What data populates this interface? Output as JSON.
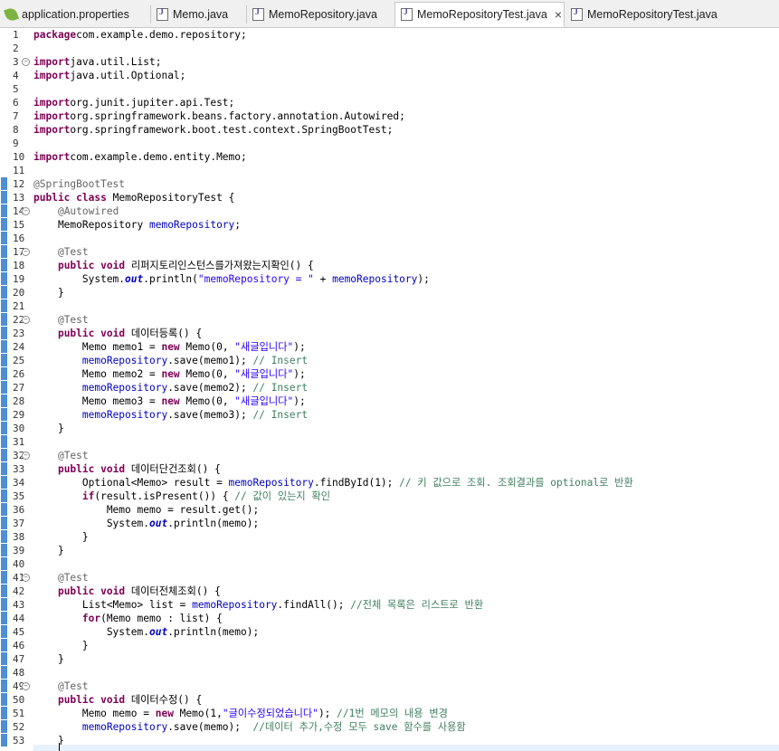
{
  "tabs": [
    {
      "label": "application.properties",
      "icon": "properties-leaf-icon"
    },
    {
      "label": "Memo.java",
      "icon": "java-file-icon"
    },
    {
      "label": "MemoRepository.java",
      "icon": "java-file-icon"
    },
    {
      "label": "MemoRepositoryTest.java",
      "icon": "java-file-icon",
      "active": true,
      "close": "×"
    },
    {
      "label": "MemoRepositoryTest.java",
      "icon": "java-file-icon"
    }
  ],
  "editor": {
    "lines": [
      {
        "n": "1",
        "fold": false,
        "tokens": [
          [
            "kw",
            "package"
          ],
          [
            "",
            "com.example.demo.repository;"
          ]
        ]
      },
      {
        "n": "2",
        "fold": false,
        "tokens": []
      },
      {
        "n": "3",
        "fold": true,
        "tokens": [
          [
            "kw",
            "import"
          ],
          [
            "",
            "java.util.List;"
          ]
        ]
      },
      {
        "n": "4",
        "fold": false,
        "tokens": [
          [
            "kw",
            "import"
          ],
          [
            "",
            "java.util.Optional;"
          ]
        ]
      },
      {
        "n": "5",
        "fold": false,
        "tokens": []
      },
      {
        "n": "6",
        "fold": false,
        "tokens": [
          [
            "kw",
            "import"
          ],
          [
            "",
            "org.junit.jupiter.api.Test;"
          ]
        ]
      },
      {
        "n": "7",
        "fold": false,
        "tokens": [
          [
            "kw",
            "import"
          ],
          [
            "",
            "org.springframework.beans.factory.annotation.Autowired;"
          ]
        ]
      },
      {
        "n": "8",
        "fold": false,
        "tokens": [
          [
            "kw",
            "import"
          ],
          [
            "",
            "org.springframework.boot.test.context.SpringBootTest;"
          ]
        ]
      },
      {
        "n": "9",
        "fold": false,
        "tokens": []
      },
      {
        "n": "10",
        "fold": false,
        "tokens": [
          [
            "kw",
            "import"
          ],
          [
            "",
            "com.example.demo.entity.Memo;"
          ]
        ]
      },
      {
        "n": "11",
        "fold": false,
        "tokens": []
      },
      {
        "n": "12",
        "fold": false,
        "tokens": [
          [
            "ann",
            "@SpringBootTest"
          ]
        ]
      },
      {
        "n": "13",
        "fold": false,
        "tokens": [
          [
            "kw",
            "public"
          ],
          [
            "",
            " "
          ],
          [
            "kw",
            "class"
          ],
          [
            "",
            " MemoRepositoryTest {"
          ]
        ]
      },
      {
        "n": "14",
        "fold": true,
        "tokens": [
          [
            "",
            "    "
          ],
          [
            "ann",
            "@Autowired"
          ]
        ]
      },
      {
        "n": "15",
        "fold": false,
        "tokens": [
          [
            "",
            "    MemoRepository "
          ],
          [
            "fld",
            "memoRepository"
          ],
          [
            "",
            ";"
          ]
        ]
      },
      {
        "n": "16",
        "fold": false,
        "tokens": []
      },
      {
        "n": "17",
        "fold": true,
        "tokens": [
          [
            "",
            "    "
          ],
          [
            "ann",
            "@Test"
          ]
        ]
      },
      {
        "n": "18",
        "fold": false,
        "tokens": [
          [
            "",
            "    "
          ],
          [
            "kw",
            "public"
          ],
          [
            "",
            " "
          ],
          [
            "kw",
            "void"
          ],
          [
            "",
            " 리퍼지토리인스턴스를가져왔는지확인() {"
          ]
        ]
      },
      {
        "n": "19",
        "fold": false,
        "tokens": [
          [
            "",
            "        System."
          ],
          [
            "st",
            "out"
          ],
          [
            "",
            ".println("
          ],
          [
            "str",
            "\"memoRepository = \""
          ],
          [
            "",
            " + "
          ],
          [
            "fld",
            "memoRepository"
          ],
          [
            "",
            ");"
          ]
        ]
      },
      {
        "n": "20",
        "fold": false,
        "tokens": [
          [
            "",
            "    }"
          ]
        ]
      },
      {
        "n": "21",
        "fold": false,
        "tokens": []
      },
      {
        "n": "22",
        "fold": true,
        "tokens": [
          [
            "",
            "    "
          ],
          [
            "ann",
            "@Test"
          ]
        ]
      },
      {
        "n": "23",
        "fold": false,
        "tokens": [
          [
            "",
            "    "
          ],
          [
            "kw",
            "public"
          ],
          [
            "",
            " "
          ],
          [
            "kw",
            "void"
          ],
          [
            "",
            " 데이터등록() {"
          ]
        ]
      },
      {
        "n": "24",
        "fold": false,
        "tokens": [
          [
            "",
            "        Memo memo1 = "
          ],
          [
            "kw",
            "new"
          ],
          [
            "",
            " Memo(0, "
          ],
          [
            "str",
            "\"새글입니다\""
          ],
          [
            "",
            ");"
          ]
        ]
      },
      {
        "n": "25",
        "fold": false,
        "tokens": [
          [
            "",
            "        "
          ],
          [
            "fld",
            "memoRepository"
          ],
          [
            "",
            ".save(memo1); "
          ],
          [
            "cm",
            "// Insert"
          ]
        ]
      },
      {
        "n": "26",
        "fold": false,
        "tokens": [
          [
            "",
            "        Memo memo2 = "
          ],
          [
            "kw",
            "new"
          ],
          [
            "",
            " Memo(0, "
          ],
          [
            "str",
            "\"새글입니다\""
          ],
          [
            "",
            ");"
          ]
        ]
      },
      {
        "n": "27",
        "fold": false,
        "tokens": [
          [
            "",
            "        "
          ],
          [
            "fld",
            "memoRepository"
          ],
          [
            "",
            ".save(memo2); "
          ],
          [
            "cm",
            "// Insert"
          ]
        ]
      },
      {
        "n": "28",
        "fold": false,
        "tokens": [
          [
            "",
            "        Memo memo3 = "
          ],
          [
            "kw",
            "new"
          ],
          [
            "",
            " Memo(0, "
          ],
          [
            "str",
            "\"새글입니다\""
          ],
          [
            "",
            ");"
          ]
        ]
      },
      {
        "n": "29",
        "fold": false,
        "tokens": [
          [
            "",
            "        "
          ],
          [
            "fld",
            "memoRepository"
          ],
          [
            "",
            ".save(memo3); "
          ],
          [
            "cm",
            "// Insert"
          ]
        ]
      },
      {
        "n": "30",
        "fold": false,
        "tokens": [
          [
            "",
            "    }"
          ]
        ]
      },
      {
        "n": "31",
        "fold": false,
        "tokens": []
      },
      {
        "n": "32",
        "fold": true,
        "tokens": [
          [
            "",
            "    "
          ],
          [
            "ann",
            "@Test"
          ]
        ]
      },
      {
        "n": "33",
        "fold": false,
        "tokens": [
          [
            "",
            "    "
          ],
          [
            "kw",
            "public"
          ],
          [
            "",
            " "
          ],
          [
            "kw",
            "void"
          ],
          [
            "",
            " 데이터단건조회() {"
          ]
        ]
      },
      {
        "n": "34",
        "fold": false,
        "tokens": [
          [
            "",
            "        Optional<Memo> result = "
          ],
          [
            "fld",
            "memoRepository"
          ],
          [
            "",
            ".findById(1); "
          ],
          [
            "cm",
            "// 키 값으로 조회. 조회결과를 optional로 반환"
          ]
        ]
      },
      {
        "n": "35",
        "fold": false,
        "tokens": [
          [
            "",
            "        "
          ],
          [
            "kw",
            "if"
          ],
          [
            "",
            "(result.isPresent()) { "
          ],
          [
            "cm",
            "// 값이 있는지 확인"
          ]
        ]
      },
      {
        "n": "36",
        "fold": false,
        "tokens": [
          [
            "",
            "            Memo memo = result.get();"
          ]
        ]
      },
      {
        "n": "37",
        "fold": false,
        "tokens": [
          [
            "",
            "            System."
          ],
          [
            "st",
            "out"
          ],
          [
            "",
            ".println(memo);"
          ]
        ]
      },
      {
        "n": "38",
        "fold": false,
        "tokens": [
          [
            "",
            "        }"
          ]
        ]
      },
      {
        "n": "39",
        "fold": false,
        "tokens": [
          [
            "",
            "    }"
          ]
        ]
      },
      {
        "n": "40",
        "fold": false,
        "tokens": []
      },
      {
        "n": "41",
        "fold": true,
        "tokens": [
          [
            "",
            "    "
          ],
          [
            "ann",
            "@Test"
          ]
        ]
      },
      {
        "n": "42",
        "fold": false,
        "tokens": [
          [
            "",
            "    "
          ],
          [
            "kw",
            "public"
          ],
          [
            "",
            " "
          ],
          [
            "kw",
            "void"
          ],
          [
            "",
            " 데이터전체조회() {"
          ]
        ]
      },
      {
        "n": "43",
        "fold": false,
        "tokens": [
          [
            "",
            "        List<Memo> list = "
          ],
          [
            "fld",
            "memoRepository"
          ],
          [
            "",
            ".findAll(); "
          ],
          [
            "cm",
            "//전체 목록은 리스트로 반환"
          ]
        ]
      },
      {
        "n": "44",
        "fold": false,
        "tokens": [
          [
            "",
            "        "
          ],
          [
            "kw",
            "for"
          ],
          [
            "",
            "(Memo memo : list) {"
          ]
        ]
      },
      {
        "n": "45",
        "fold": false,
        "tokens": [
          [
            "",
            "            System."
          ],
          [
            "st",
            "out"
          ],
          [
            "",
            ".println(memo);"
          ]
        ]
      },
      {
        "n": "46",
        "fold": false,
        "tokens": [
          [
            "",
            "        }"
          ]
        ]
      },
      {
        "n": "47",
        "fold": false,
        "tokens": [
          [
            "",
            "    }"
          ]
        ]
      },
      {
        "n": "48",
        "fold": false,
        "tokens": []
      },
      {
        "n": "49",
        "fold": true,
        "tokens": [
          [
            "",
            "    "
          ],
          [
            "ann",
            "@Test"
          ]
        ]
      },
      {
        "n": "50",
        "fold": false,
        "tokens": [
          [
            "",
            "    "
          ],
          [
            "kw",
            "public"
          ],
          [
            "",
            " "
          ],
          [
            "kw",
            "void"
          ],
          [
            "",
            " 데이터수정() {"
          ]
        ]
      },
      {
        "n": "51",
        "fold": false,
        "tokens": [
          [
            "",
            "        Memo memo = "
          ],
          [
            "kw",
            "new"
          ],
          [
            "",
            " Memo(1,"
          ],
          [
            "str",
            "\"글이수정되었습니다\""
          ],
          [
            "",
            "); "
          ],
          [
            "cm",
            "//1번 메모의 내용 변경"
          ]
        ]
      },
      {
        "n": "52",
        "fold": false,
        "tokens": [
          [
            "",
            "        "
          ],
          [
            "fld",
            "memoRepository"
          ],
          [
            "",
            ".save(memo);  "
          ],
          [
            "cm",
            "//데이터 추가,수정 모두 save 함수를 사용함"
          ]
        ]
      },
      {
        "n": "53",
        "fold": false,
        "tokens": [
          [
            "",
            "    }"
          ]
        ]
      }
    ],
    "ruler_marks_from_line": 12
  },
  "colors": {
    "keyword": "#7f0055",
    "string": "#2a00ff",
    "comment": "#3f7f5f",
    "annotation": "#646464",
    "field": "#0000c0",
    "ruler": "#4c8fd6"
  }
}
